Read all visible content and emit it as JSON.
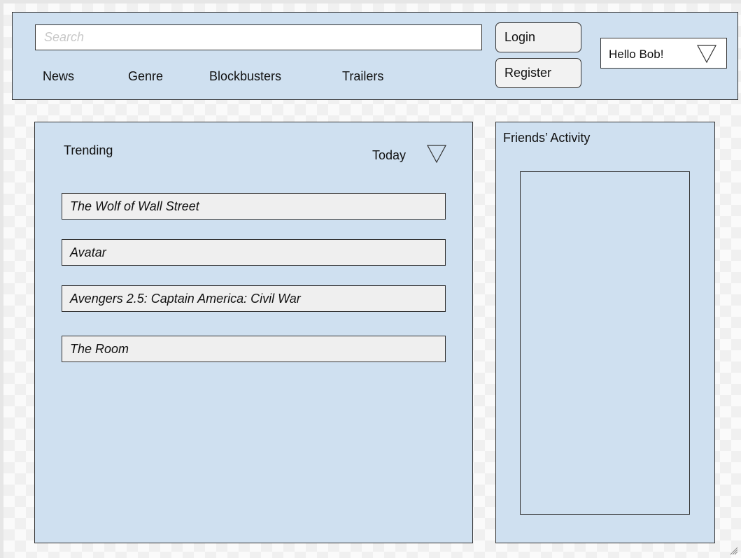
{
  "header": {
    "search_placeholder": "Search",
    "nav": [
      {
        "label": "News"
      },
      {
        "label": "Genre"
      },
      {
        "label": "Blockbusters"
      },
      {
        "label": "Trailers"
      }
    ],
    "login_label": "Login",
    "register_label": "Register",
    "user_menu": {
      "label": "Hello Bob!",
      "icon": "chevron-down-icon"
    }
  },
  "trending": {
    "title": "Trending",
    "period": {
      "label": "Today",
      "icon": "chevron-down-icon"
    },
    "items": [
      {
        "title": "The Wolf of Wall Street"
      },
      {
        "title": "Avatar"
      },
      {
        "title": "Avengers 2.5: Captain America: Civil War"
      },
      {
        "title": "The Room"
      }
    ]
  },
  "friends": {
    "title": "Friends’ Activity"
  },
  "colors": {
    "panel": "#cfe0f0",
    "item": "#efefef",
    "border": "#333333"
  }
}
